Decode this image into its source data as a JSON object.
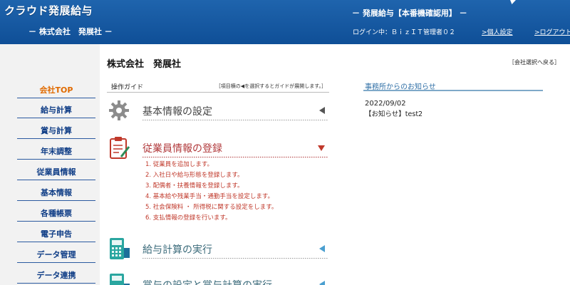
{
  "header": {
    "app_logo": "クラウド発展給与",
    "company": "－ 株式会社　発展社 －",
    "environment": "－ 発展給与【本番機確認用】 －",
    "login_info": "ログイン中：ＢｉｚＩＴ管理者０２",
    "personal_settings": ">個人設定",
    "logout": ">ログアウト"
  },
  "sidebar": {
    "items": [
      {
        "label": "会社TOP",
        "active": true
      },
      {
        "label": "給与計算",
        "active": false
      },
      {
        "label": "賞与計算",
        "active": false
      },
      {
        "label": "年末調整",
        "active": false
      },
      {
        "label": "従業員情報",
        "active": false
      },
      {
        "label": "基本情報",
        "active": false
      },
      {
        "label": "各種帳票",
        "active": false
      },
      {
        "label": "電子申告",
        "active": false
      },
      {
        "label": "データ管理",
        "active": false
      },
      {
        "label": "データ連携",
        "active": false
      }
    ]
  },
  "main": {
    "page_title": "株式会社　発展社",
    "company_select": "［会社選択へ戻る］",
    "guide": {
      "title": "操作ガイド",
      "hint": "［項目横の◀を選択するとガイドが展開します。］",
      "sections": [
        {
          "title": "基本情報の設定",
          "icon": "gear-icon"
        },
        {
          "title": "従業員情報の登録",
          "icon": "clipboard-icon"
        },
        {
          "title": "給与計算の実行",
          "icon": "calculator-icon"
        },
        {
          "title": "賞与の設定と賞与計算の実行",
          "icon": "calculator-icon"
        }
      ],
      "employee_steps": [
        "1. 従業員を追加します。",
        "2. 入社日や給与形態を登録します。",
        "3. 配偶者・扶養情報を登録します。",
        "4. 基本給や残業手当・通勤手当を設定します。",
        "5. 社会保険料 ・ 所得税に関する設定をします。",
        "6. 支払情報の登録を行います。"
      ]
    },
    "notices": {
      "title": "事務所からのお知らせ",
      "date": "2022/09/02",
      "text": "【お知らせ】test2"
    }
  },
  "colors": {
    "header_blue": "#1a5ea8",
    "nav_text": "#0f3d86",
    "nav_active": "#e06a00",
    "accent_red": "#b0383a",
    "accent_teal": "#4a9fd0"
  }
}
